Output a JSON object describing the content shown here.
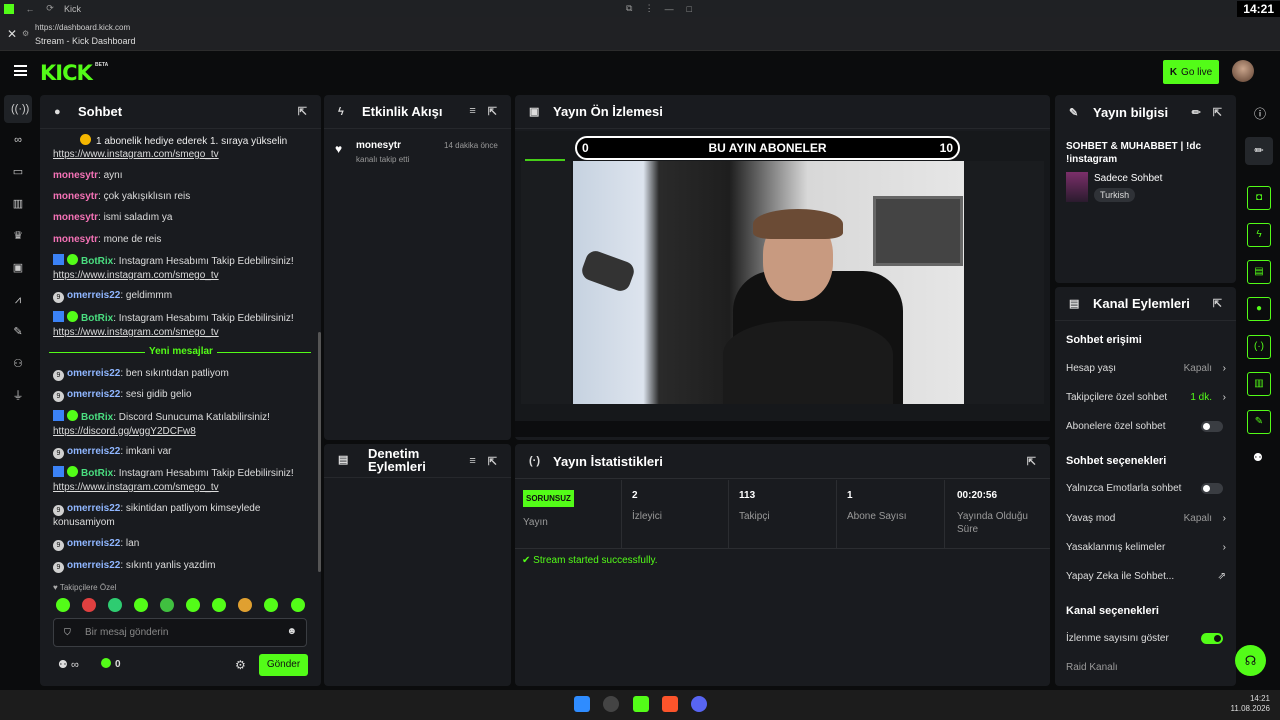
{
  "browser": {
    "tab_title": "Kick",
    "clock": "14:21",
    "url": "https://dashboard.kick.com",
    "page_title": "Stream - Kick Dashboard"
  },
  "topnav": {
    "logo": "KICK",
    "beta": "BETA",
    "go_live": "Go live"
  },
  "chat": {
    "title": "Sohbet",
    "pinned": "1 abonelik hediye ederek 1. sıraya yükselin",
    "lines": [
      {
        "user": "",
        "text": "https://www.instagram.com/smego_tv"
      },
      {
        "user": "monesytr",
        "text": ": aynı"
      },
      {
        "user": "monesytr",
        "text": ": çok yakışıklısın reis"
      },
      {
        "user": "monesytr",
        "text": ": ismi saladım ya"
      },
      {
        "user": "monesytr",
        "text": ": mone de reis"
      },
      {
        "user": "BotRix",
        "text": ": Instagram Hesabımı Takip Edebilirsiniz!",
        "link": "https://www.instagram.com/smego_tv"
      },
      {
        "user": "omerreis22",
        "text": ": geldimmm"
      },
      {
        "user": "BotRix",
        "text": ": Instagram Hesabımı Takip Edebilirsiniz!",
        "link": "https://www.instagram.com/smego_tv"
      },
      {
        "user": "omerreis22",
        "text": ": ben sıkıntıdan patliyom"
      },
      {
        "user": "omerreis22",
        "text": ": sesi gidib gelio"
      },
      {
        "user": "BotRix",
        "text": ": Discord Sunucuma Katılabilirsiniz!",
        "link": "https://discord.gg/wggY2DCFw8"
      },
      {
        "user": "omerreis22",
        "text": ": imkani var"
      },
      {
        "user": "BotRix",
        "text": ": Instagram Hesabımı Takip Edebilirsiniz!",
        "link": "https://www.instagram.com/smego_tv"
      },
      {
        "user": "omerreis22",
        "text": ": sikintidan patliyom kimseylede konusamiyom"
      },
      {
        "user": "omerreis22",
        "text": ": lan"
      },
      {
        "user": "omerreis22",
        "text": ": sıkıntı yanlis yazdim"
      }
    ],
    "new_messages": "Yeni mesajlar",
    "followers_only": "Takipçilere Özel",
    "input_placeholder": "Bir mesaj gönderin",
    "points": "∞",
    "kick_points": "0",
    "send": "Gönder"
  },
  "activity": {
    "title": "Etkinlik Akışı",
    "items": [
      {
        "user": "monesytr",
        "time": "14 dakika önce",
        "action": "kanalı takip etti"
      }
    ]
  },
  "moderation": {
    "title_line1": "Denetim",
    "title_line2": "Eylemleri"
  },
  "preview": {
    "title": "Yayın Ön İzlemesi",
    "goal_left": "0",
    "goal_title": "BU AYIN ABONELER",
    "goal_right": "10"
  },
  "stats": {
    "title": "Yayın İstatistikleri",
    "badge": "SORUNSUZ",
    "badge_label": "Yayın",
    "viewers": "2",
    "viewers_label": "İzleyici",
    "followers": "113",
    "followers_label": "Takipçi",
    "subs": "1",
    "subs_label": "Abone Sayısı",
    "uptime": "00:20:56",
    "uptime_label": "Yayında Olduğu Süre",
    "status": "Stream started successfully."
  },
  "stream_info": {
    "title": "Yayın bilgisi",
    "stream_title": "SOHBET & MUHABBET | !dc !instagram",
    "category": "Sadece Sohbet",
    "language": "Turkish"
  },
  "channel_actions": {
    "title": "Kanal Eylemleri",
    "chat_access": "Sohbet erişimi",
    "account_age": "Hesap yaşı",
    "account_age_val": "Kapalı",
    "followers_chat": "Takipçilere özel sohbet",
    "followers_chat_val": "1 dk.",
    "subs_chat": "Abonelere özel sohbet",
    "chat_options": "Sohbet seçenekleri",
    "emote_only": "Yalnızca Emotlarla sohbet",
    "slow_mode": "Yavaş mod",
    "slow_mode_val": "Kapalı",
    "banned_words": "Yasaklanmış kelimeler",
    "ai_chat": "Yapay Zeka ile Sohbet...",
    "channel_options": "Kanal seçenekleri",
    "show_viewers": "İzlenme sayısını göster",
    "raid": "Raid Kanalı"
  },
  "taskbar": {
    "time": "14:21",
    "date": "11.08.2026"
  },
  "colors": {
    "accent": "#53fc18",
    "panel": "#191b1f",
    "bg": "#0b0c0d"
  }
}
